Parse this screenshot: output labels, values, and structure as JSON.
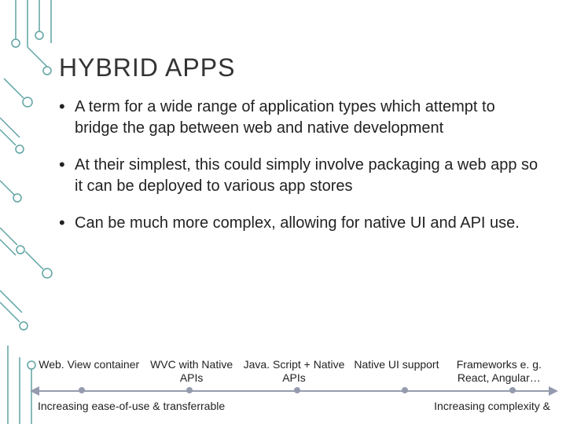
{
  "title": "HYBRID APPS",
  "bullets": [
    "A term for a wide range of application types which attempt to bridge the gap between web and native development",
    "At their simplest, this could simply involve packaging a web app so it can be deployed to various app stores",
    "Can be much more complex, allowing for native UI and API use."
  ],
  "spectrum": {
    "labels": [
      "Web. View container",
      "WVC with Native APIs",
      "Java. Script + Native APIs",
      "Native UI support",
      "Frameworks e. g. React, Angular…"
    ],
    "caption_left": "Increasing ease-of-use & transferrable",
    "caption_right": "Increasing complexity &"
  },
  "decoration_color": "#5fa3a3"
}
